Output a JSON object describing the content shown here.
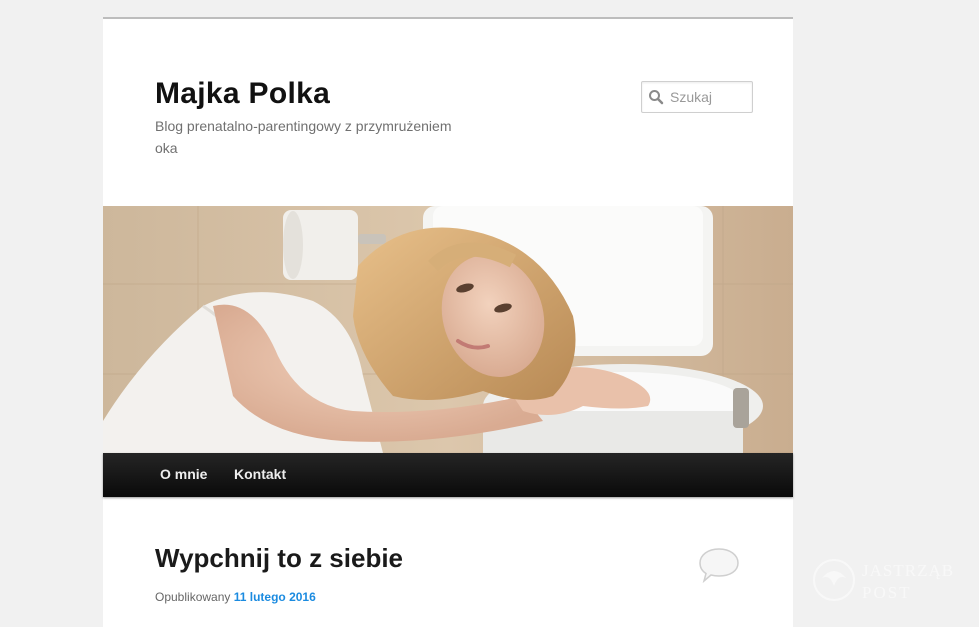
{
  "site": {
    "title": "Majka Polka",
    "description": "Blog prenatalno-parentingowy z przymrużeniem oka"
  },
  "search": {
    "placeholder": "Szukaj",
    "icon": "search-icon"
  },
  "header_image": {
    "description_icon": "header-photo"
  },
  "nav": {
    "items": [
      {
        "label": "O mnie"
      },
      {
        "label": "Kontakt"
      }
    ]
  },
  "post": {
    "title": "Wypchnij to z siebie",
    "meta_prefix": "Opublikowany",
    "date": "11 lutego 2016",
    "comment_icon": "comment-bubble-icon"
  },
  "watermark": {
    "line1": "JASTRZĄB",
    "line2": "POST"
  },
  "colors": {
    "link": "#1b8be0",
    "nav_bg": "#111111",
    "page_bg": "#f1f1f1"
  }
}
